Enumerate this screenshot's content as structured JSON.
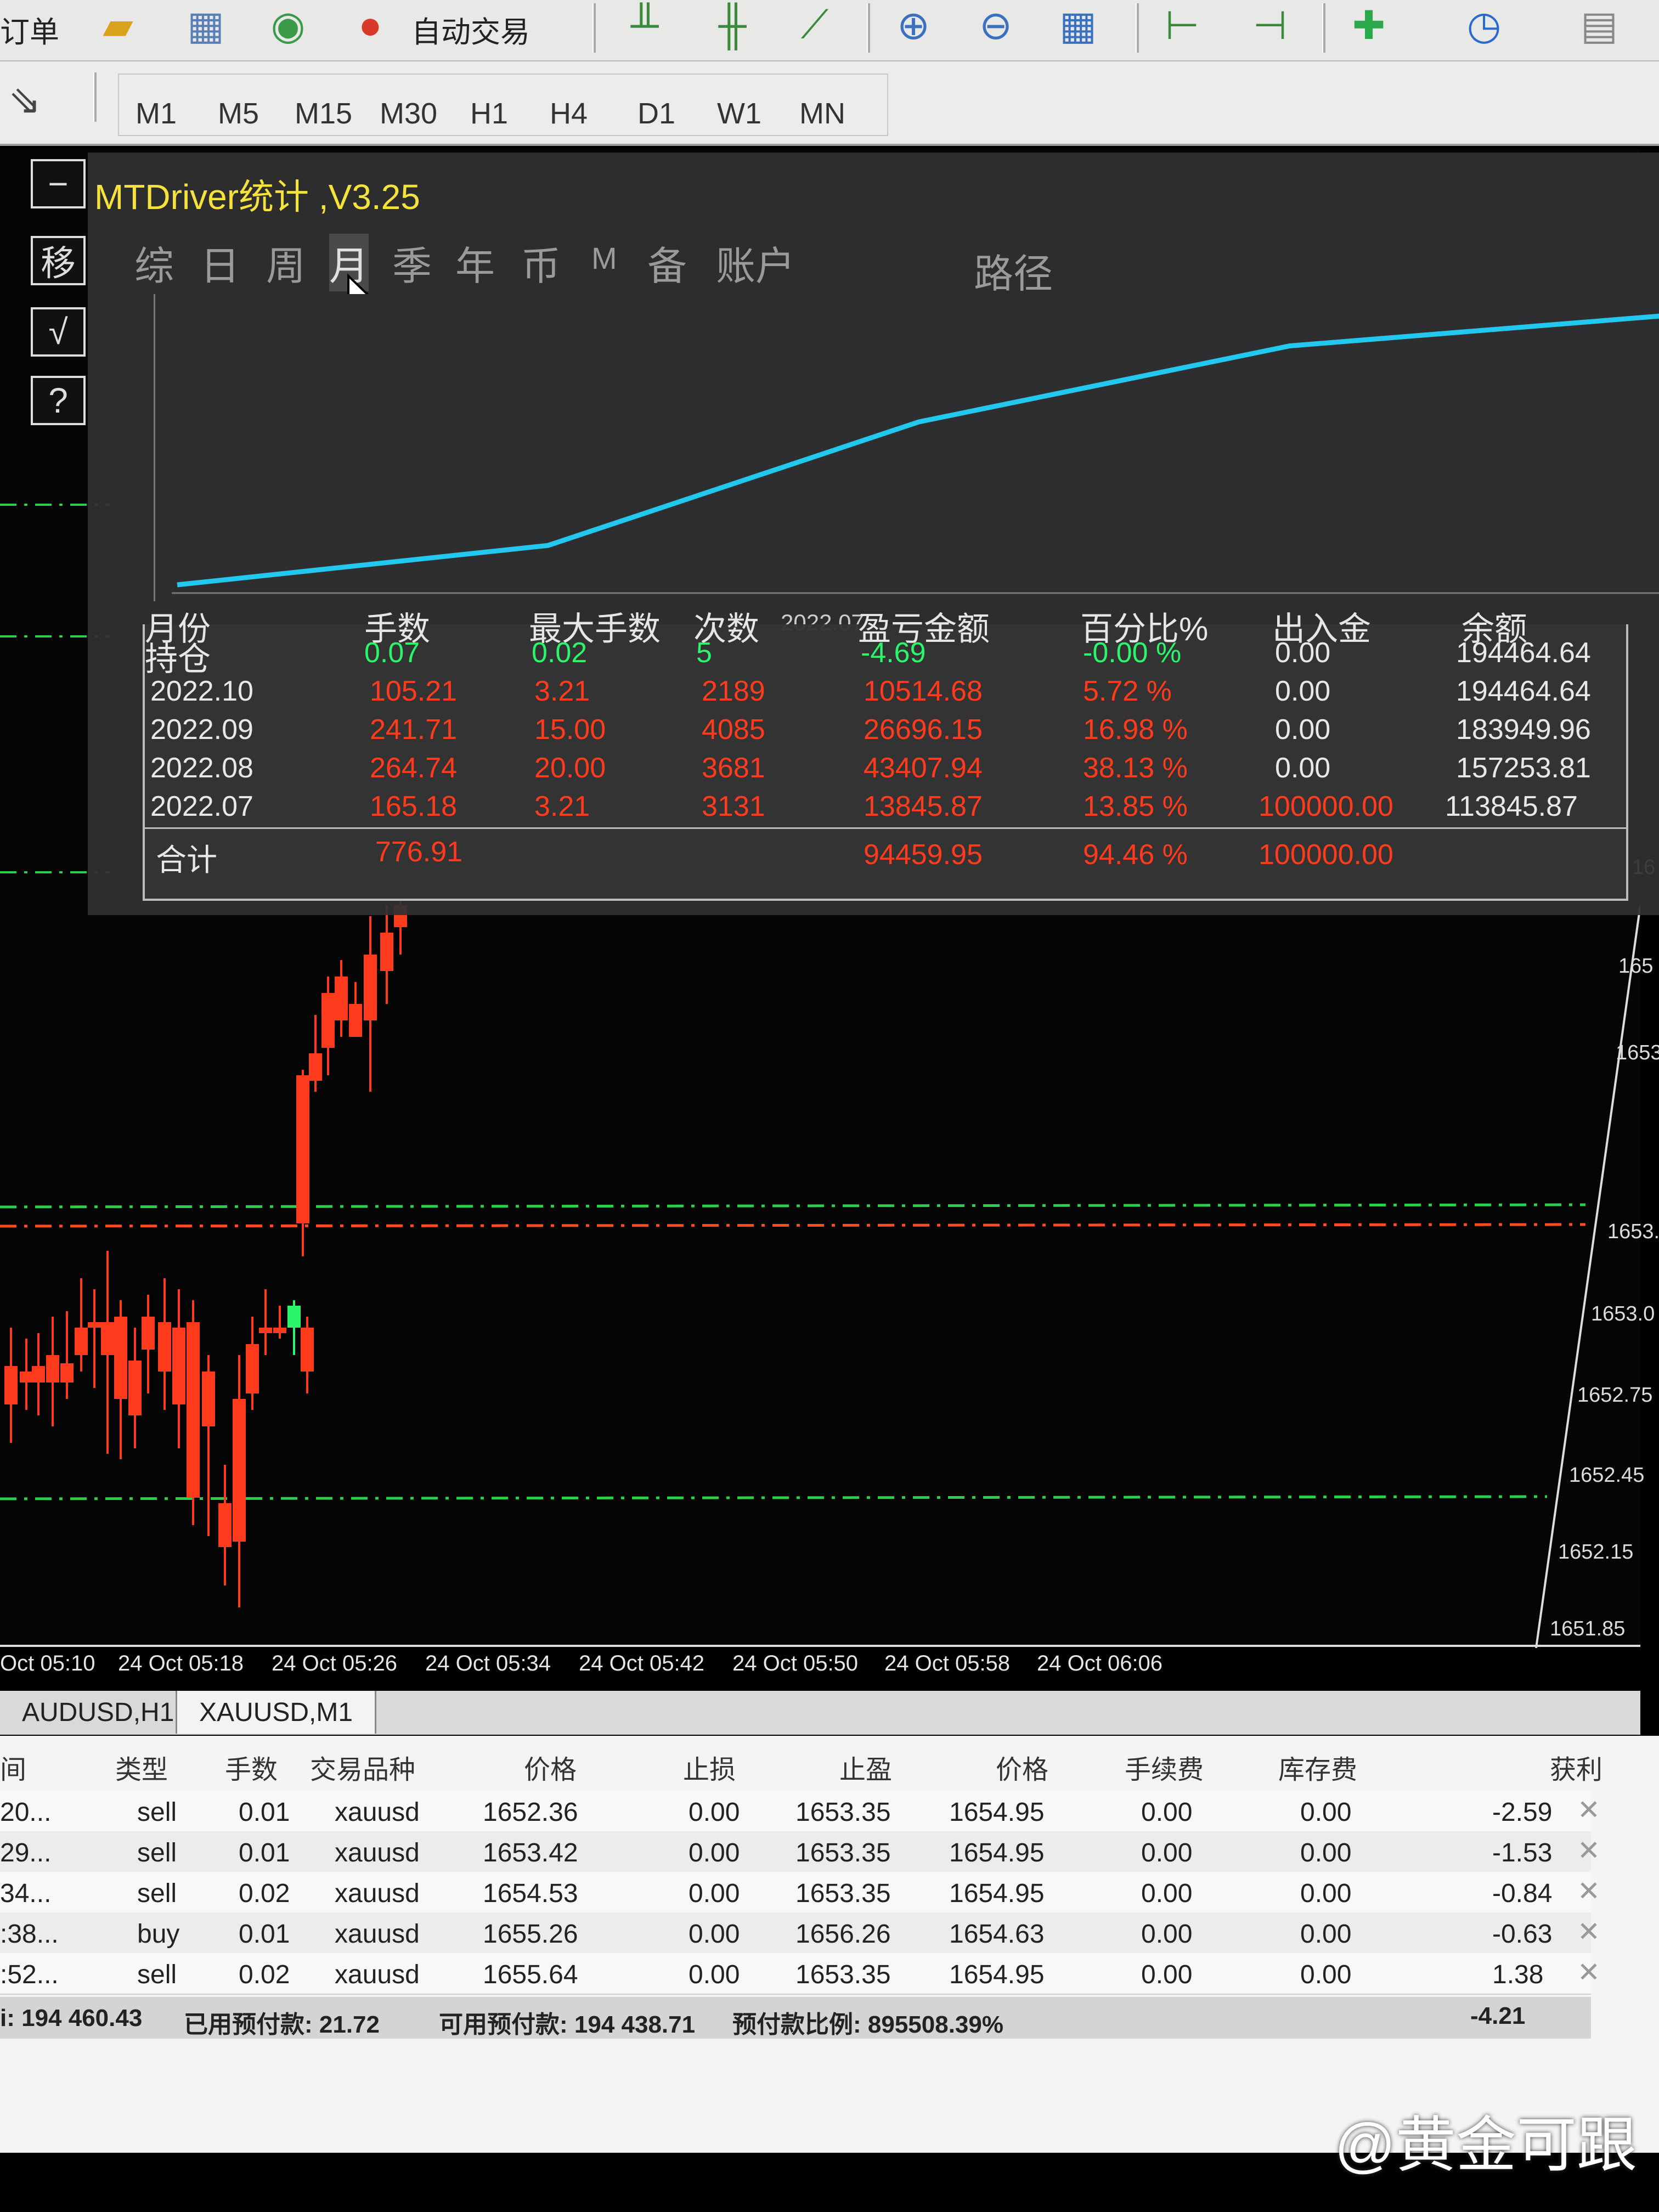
{
  "toolbar": {
    "left_label": "订单",
    "auto_trade_label": "自动交易",
    "timeframes": [
      "M1",
      "M5",
      "M15",
      "M30",
      "H1",
      "H4",
      "D1",
      "W1",
      "MN"
    ]
  },
  "side_tools": [
    "−",
    "移",
    "√",
    "?"
  ],
  "panel": {
    "title": "MTDriver统计 ,V3.25",
    "tabs": [
      "综",
      "日",
      "周",
      "月",
      "季",
      "年",
      "币",
      "M",
      "备",
      "账户",
      "路径"
    ],
    "active_tab": "月",
    "curve_label": "2022.07",
    "table": {
      "headers": [
        "月份",
        "手数",
        "最大手数",
        "次数",
        "盈亏金额",
        "百分比%",
        "出入金",
        "余额"
      ],
      "rows": [
        {
          "month": "持仓",
          "lots": "0.07",
          "max_lots": "0.02",
          "count": "5",
          "pnl": "-4.69",
          "pct": "-0.00 %",
          "deposit": "0.00",
          "balance": "194464.64"
        },
        {
          "month": "2022.10",
          "lots": "105.21",
          "max_lots": "3.21",
          "count": "2189",
          "pnl": "10514.68",
          "pct": "5.72 %",
          "deposit": "0.00",
          "balance": "194464.64"
        },
        {
          "month": "2022.09",
          "lots": "241.71",
          "max_lots": "15.00",
          "count": "4085",
          "pnl": "26696.15",
          "pct": "16.98 %",
          "deposit": "0.00",
          "balance": "183949.96"
        },
        {
          "month": "2022.08",
          "lots": "264.74",
          "max_lots": "20.00",
          "count": "3681",
          "pnl": "43407.94",
          "pct": "38.13 %",
          "deposit": "0.00",
          "balance": "157253.81"
        },
        {
          "month": "2022.07",
          "lots": "165.18",
          "max_lots": "3.21",
          "count": "3131",
          "pnl": "13845.87",
          "pct": "13.85 %",
          "deposit": "100000.00",
          "balance": "113845.87"
        }
      ],
      "total": {
        "label": "合计",
        "lots": "776.91",
        "pnl": "94459.95",
        "pct": "94.46 %",
        "deposit": "100000.00"
      }
    }
  },
  "price_axis": [
    "16",
    "165",
    "1653",
    "1653.",
    "1653.0",
    "1652.75",
    "1652.45",
    "1652.15",
    "1651.85"
  ],
  "time_axis": [
    "Oct 05:10",
    "24 Oct 05:18",
    "24 Oct 05:26",
    "24 Oct 05:34",
    "24 Oct 05:42",
    "24 Oct 05:50",
    "24 Oct 05:58",
    "24 Oct 06:06"
  ],
  "chart_tabs": [
    "AUDUSD,H1",
    "XAUUSD,M1"
  ],
  "terminal": {
    "headers": [
      "间",
      "类型",
      "手数",
      "交易品种",
      "价格",
      "止损",
      "止盈",
      "价格",
      "手续费",
      "库存费",
      "获利"
    ],
    "rows": [
      {
        "time": "20...",
        "type": "sell",
        "lots": "0.01",
        "symbol": "xauusd",
        "price": "1652.36",
        "sl": "0.00",
        "tp": "1653.35",
        "cur": "1654.95",
        "fee": "0.00",
        "swap": "0.00",
        "profit": "-2.59"
      },
      {
        "time": "29...",
        "type": "sell",
        "lots": "0.01",
        "symbol": "xauusd",
        "price": "1653.42",
        "sl": "0.00",
        "tp": "1653.35",
        "cur": "1654.95",
        "fee": "0.00",
        "swap": "0.00",
        "profit": "-1.53"
      },
      {
        "time": "34...",
        "type": "sell",
        "lots": "0.02",
        "symbol": "xauusd",
        "price": "1654.53",
        "sl": "0.00",
        "tp": "1653.35",
        "cur": "1654.95",
        "fee": "0.00",
        "swap": "0.00",
        "profit": "-0.84"
      },
      {
        "time": ":38...",
        "type": "buy",
        "lots": "0.01",
        "symbol": "xauusd",
        "price": "1655.26",
        "sl": "0.00",
        "tp": "1656.26",
        "cur": "1654.63",
        "fee": "0.00",
        "swap": "0.00",
        "profit": "-0.63"
      },
      {
        "time": ":52...",
        "type": "sell",
        "lots": "0.02",
        "symbol": "xauusd",
        "price": "1655.64",
        "sl": "0.00",
        "tp": "1653.35",
        "cur": "1654.95",
        "fee": "0.00",
        "swap": "0.00",
        "profit": "1.38"
      }
    ],
    "summary": {
      "balance": "i: 194 460.43",
      "used_margin": "已用预付款: 21.72",
      "free_margin": "可用预付款: 194 438.71",
      "margin_level": "预付款比例: 895508.39%",
      "total_profit": "-4.21"
    }
  },
  "watermark": "@黄金可跟",
  "colors": {
    "bull": "#2bf56a",
    "bear": "#ff3b1e",
    "curve": "#22c8ee",
    "title": "#f5e23c"
  }
}
